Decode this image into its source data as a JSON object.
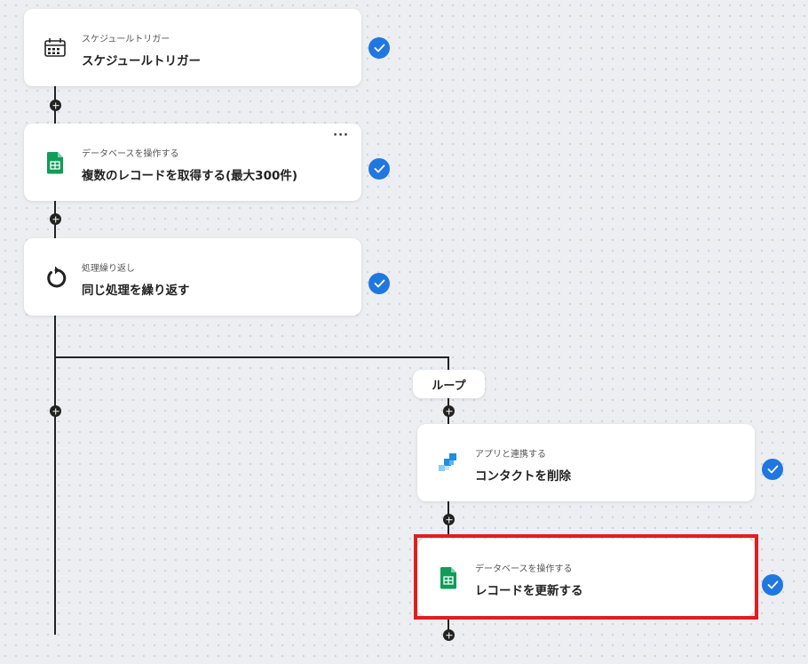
{
  "steps": [
    {
      "subtitle": "スケジュールトリガー",
      "title": "スケジュールトリガー",
      "icon": "calendar-icon"
    },
    {
      "subtitle": "データベースを操作する",
      "title": "複数のレコードを取得する(最大300件)",
      "icon": "sheets-icon",
      "more": "···"
    },
    {
      "subtitle": "処理繰り返し",
      "title": "同じ処理を繰り返す",
      "icon": "loop-icon"
    },
    {
      "subtitle": "アプリと連携する",
      "title": "コンタクトを削除",
      "icon": "app-icon"
    },
    {
      "subtitle": "データベースを操作する",
      "title": "レコードを更新する",
      "icon": "sheets-icon"
    }
  ],
  "loop_label": "ループ",
  "colors": {
    "check": "#2077e0",
    "highlight": "#e01e1e",
    "sheets_green": "#0f9d58",
    "app_blue": "#1d8ee0"
  }
}
